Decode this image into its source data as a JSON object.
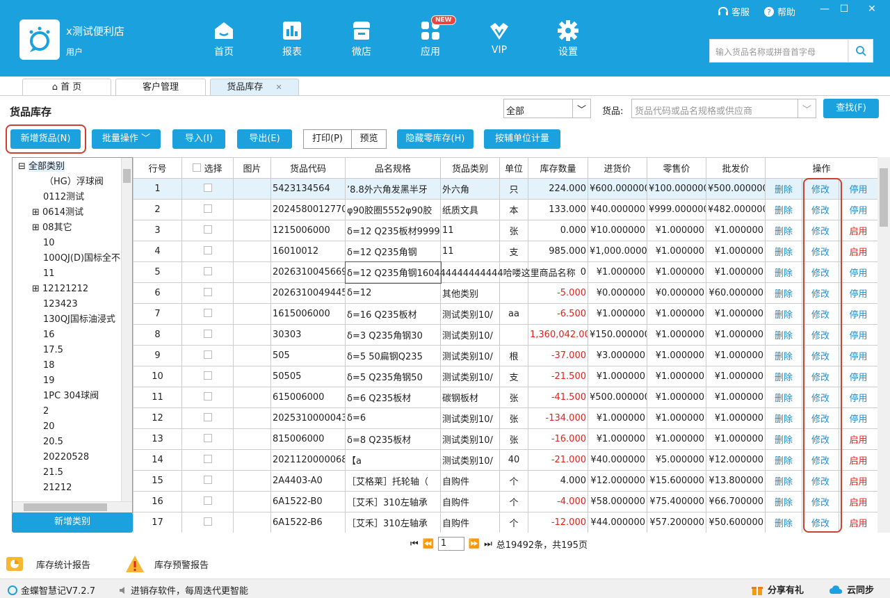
{
  "header": {
    "shop_name": "x测试便利店",
    "user_label": "用户",
    "search_placeholder": "输入货品名称或拼音首字母",
    "service_label": "客服",
    "help_label": "帮助",
    "nav": [
      {
        "label": "首页",
        "icon": "home-icon"
      },
      {
        "label": "报表",
        "icon": "report-icon"
      },
      {
        "label": "微店",
        "icon": "shop-icon"
      },
      {
        "label": "应用",
        "icon": "apps-icon"
      },
      {
        "label": "VIP",
        "icon": "vip-icon"
      },
      {
        "label": "设置",
        "icon": "gear-icon"
      }
    ],
    "new_badge": "NEW"
  },
  "tabs": [
    {
      "label": "首 页"
    },
    {
      "label": "客户管理"
    },
    {
      "label": "货品库存"
    }
  ],
  "page": {
    "title": "货品库存",
    "filter_value": "全部",
    "goods_label": "货品:",
    "goods_placeholder": "货品代码或品名规格或供应商",
    "search_button": "查找(F)"
  },
  "toolbar": {
    "add": "新增货品(N)",
    "batch": "批量操作",
    "import": "导入(I)",
    "export": "导出(E)",
    "print": "打印(P)",
    "preview": "预览",
    "hide_zero": "隐藏零库存(H)",
    "aux_unit": "按辅单位计量"
  },
  "tree": {
    "items": [
      "全部类别",
      "（HG）浮球阀",
      "0112测试",
      "0614测试",
      "08其它",
      "10",
      "100QJ(D)国标全不",
      "11",
      "12121212",
      "123423",
      "130QJ国标油浸式",
      "16",
      "17.5",
      "18",
      "19",
      "1PC 304球阀",
      "2",
      "20",
      "20.5",
      "20220528",
      "21.5",
      "21212"
    ],
    "add_category": "新增类别"
  },
  "table": {
    "headers": [
      "行号",
      "选择",
      "图片",
      "货品代码",
      "品名规格",
      "货品类别",
      "单位",
      "库存数量",
      "进货价",
      "零售价",
      "批发价",
      "操作"
    ],
    "actions": {
      "delete": "删除",
      "modify": "修改"
    },
    "rows": [
      [
        "1",
        "5423134564",
        "’8.8外六角发黑半牙",
        "外六角",
        "只",
        "224.000",
        "¥600.000000",
        "¥100.000000",
        "¥500.000000",
        "停用"
      ],
      [
        "2",
        "2024580012770",
        "φ90胶圈5552φ90胶",
        "纸质文具",
        "本",
        "133.000",
        "¥40.000000",
        "¥999.000000",
        "¥482.000000",
        "停用"
      ],
      [
        "3",
        "1215006000",
        "δ=12 Q235板材9999",
        "11",
        "张",
        "0.000",
        "¥10.000000",
        "¥1.000000",
        "¥1.000000",
        "启用"
      ],
      [
        "4",
        "16010012",
        "δ=12 Q235角钢",
        "11",
        "支",
        "985.000",
        "¥1,000.000000",
        "¥1.000000",
        "¥1.000000",
        "启用"
      ],
      [
        "5",
        "2026310045669",
        "δ=12 Q235角钢160444444444444哈喽这里商品名称",
        "",
        "",
        "0",
        "¥1.000000",
        "¥1.000000",
        "¥1.000000",
        "停用"
      ],
      [
        "6",
        "2026310049445",
        "δ=12",
        "其他类别",
        "",
        "-5.000",
        "¥0.000000",
        "¥0.000000",
        "¥60.000000",
        "停用"
      ],
      [
        "7",
        "1615006000",
        "δ=16 Q235板材",
        "测试类别10/",
        "aa",
        "-6.500",
        "¥1.000000",
        "¥1.000000",
        "¥1.000000",
        "停用"
      ],
      [
        "8",
        "30303",
        "δ=3 Q235角钢30",
        "测试类别10/",
        "",
        "1,360,042.000",
        "¥150.000000",
        "¥1.000000",
        "¥1.000000",
        "停用"
      ],
      [
        "9",
        "505",
        "δ=5 50扁钢Q235",
        "测试类别10/",
        "根",
        "-37.000",
        "¥3.000000",
        "¥1.000000",
        "¥1.000000",
        "停用"
      ],
      [
        "10",
        "50505",
        "δ=5 Q235角钢50",
        "测试类别10/",
        "支",
        "-21.500",
        "¥1.000000",
        "¥1.000000",
        "¥1.000000",
        "停用"
      ],
      [
        "11",
        "615006000",
        "δ=6 Q235板材",
        "碳钢板材",
        "张",
        "-41.500",
        "¥500.000000",
        "¥1.000000",
        "¥1.000000",
        "停用"
      ],
      [
        "12",
        "2025310000043",
        "δ=6",
        "测试类别10/",
        "张",
        "-134.000",
        "¥1.000000",
        "¥1.000000",
        "¥1.000000",
        "停用"
      ],
      [
        "13",
        "815006000",
        "δ=8 Q235板材",
        "测试类别10/",
        "张",
        "-16.000",
        "¥1.000000",
        "¥1.000000",
        "¥1.000000",
        "启用"
      ],
      [
        "14",
        "2021120000068",
        "【a",
        "测试类别10/",
        "40",
        "-21.000",
        "¥40.000000",
        "¥5.000000",
        "¥12.000000",
        "启用"
      ],
      [
        "15",
        "2A4403-A0",
        "［艾格莱］托轮轴（",
        "自购件",
        "个",
        "4.000",
        "¥12.000000",
        "¥15.600000",
        "¥13.800000",
        "启用"
      ],
      [
        "16",
        "6A1522-B0",
        "［艾禾］310左轴承",
        "自购件",
        "个",
        "-4.000",
        "¥58.000000",
        "¥75.400000",
        "¥66.700000",
        "启用"
      ],
      [
        "17",
        "6A1522-B6",
        "［艾禾］310左轴承",
        "自购件",
        "个",
        "-12.000",
        "¥44.000000",
        "¥57.200000",
        "¥50.600000",
        "启用"
      ]
    ]
  },
  "pager": {
    "page": "1",
    "summary": "总19492条，共195页"
  },
  "reports": {
    "stats": "库存统计报告",
    "warning": "库存预警报告"
  },
  "status": {
    "version": "金蝶智慧记V7.2.7",
    "tip": "进销存软件，每周迭代更智能",
    "share": "分享有礼",
    "sync": "云同步"
  }
}
